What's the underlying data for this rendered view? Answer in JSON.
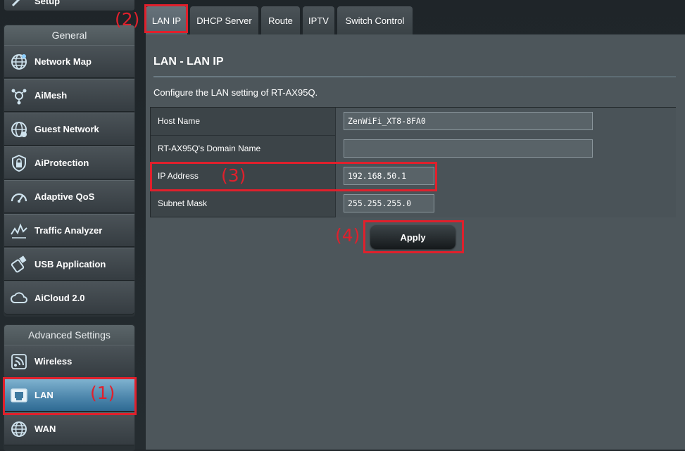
{
  "sidebar": {
    "top_item": "Setup",
    "general_header": "General",
    "general_items": [
      {
        "label": "Network Map",
        "icon": "globe-icon"
      },
      {
        "label": "AiMesh",
        "icon": "aimesh-icon"
      },
      {
        "label": "Guest Network",
        "icon": "guest-network-icon"
      },
      {
        "label": "AiProtection",
        "icon": "lock-shield-icon"
      },
      {
        "label": "Adaptive QoS",
        "icon": "gauge-icon"
      },
      {
        "label": "Traffic Analyzer",
        "icon": "traffic-analyzer-icon"
      },
      {
        "label": "USB Application",
        "icon": "usb-icon"
      },
      {
        "label": "AiCloud 2.0",
        "icon": "cloud-icon"
      }
    ],
    "advanced_header": "Advanced Settings",
    "advanced_items": [
      {
        "label": "Wireless",
        "icon": "wireless-icon"
      },
      {
        "label": "LAN",
        "icon": "lan-icon",
        "active": true
      },
      {
        "label": "WAN",
        "icon": "wan-globe-icon"
      }
    ]
  },
  "tabs": [
    {
      "label": "LAN IP",
      "active": true
    },
    {
      "label": "DHCP Server"
    },
    {
      "label": "Route"
    },
    {
      "label": "IPTV"
    },
    {
      "label": "Switch Control"
    }
  ],
  "main": {
    "title": "LAN - LAN IP",
    "description": "Configure the LAN setting of RT-AX95Q.",
    "fields": [
      {
        "label": "Host Name",
        "value": "ZenWiFi_XT8-8FA0"
      },
      {
        "label": "RT-AX95Q's Domain Name",
        "value": ""
      },
      {
        "label": "IP Address",
        "value": "192.168.50.1"
      },
      {
        "label": "Subnet Mask",
        "value": "255.255.255.0"
      }
    ],
    "apply_label": "Apply"
  },
  "annotations": {
    "step1": "(1)",
    "step2": "(2)",
    "step3": "(3)",
    "step4": "(4)"
  },
  "colors": {
    "annotation_red": "#e0202c",
    "active_blue": "#4f88ad"
  }
}
